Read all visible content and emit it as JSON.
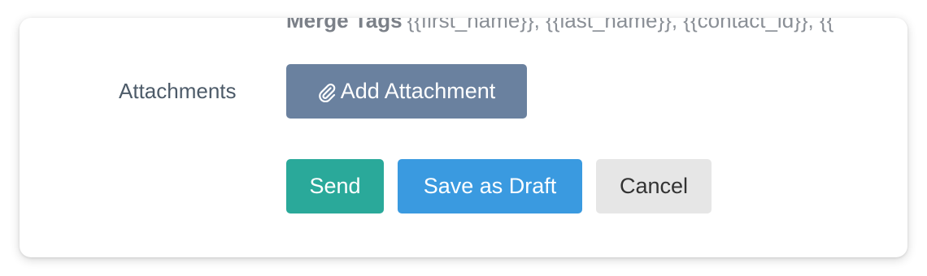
{
  "merge_tags": {
    "label": "Merge Tags",
    "values": "{{first_name}}, {{last_name}}, {{contact_id}}, {{"
  },
  "attachments": {
    "label": "Attachments",
    "add_button_label": "Add Attachment",
    "add_button_icon": "paperclip-icon"
  },
  "actions": {
    "send_label": "Send",
    "draft_label": "Save as Draft",
    "cancel_label": "Cancel"
  },
  "colors": {
    "attach_button": "#6a819f",
    "send_button": "#2aa99a",
    "draft_button": "#3a9ae0",
    "cancel_button": "#e6e6e6"
  }
}
